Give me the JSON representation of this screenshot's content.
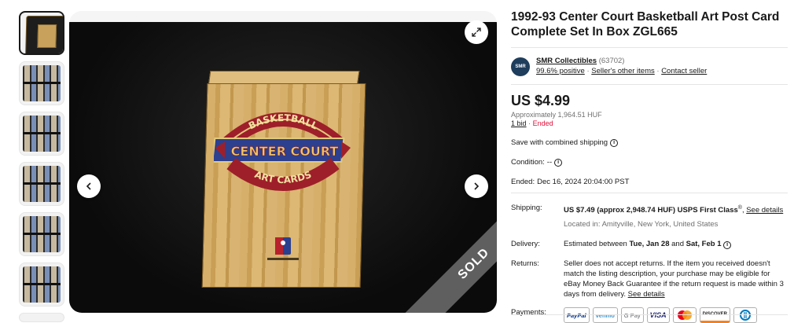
{
  "listing": {
    "title": "1992-93 Center Court Basketball Art Post Card Complete Set In Box ZGL665"
  },
  "gallery": {
    "sold_label": "SOLD",
    "box_logo": {
      "top_word": "BASKETBALL",
      "middle_word": "CENTER COURT",
      "bottom_word": "ART CARDS"
    }
  },
  "seller": {
    "avatar_text": "SMR",
    "name": "SMR Collectibles",
    "feedback_count": "(63702)",
    "positive": "99.6% positive",
    "other_items": "Seller's other items",
    "contact": "Contact seller",
    "sep": "·"
  },
  "price": {
    "main": "US $4.99",
    "approx_label": "Approximately",
    "approx_value": "1,964.51 HUF",
    "bids": "1 bid",
    "status": "Ended"
  },
  "shipping_note": "Save with combined shipping",
  "condition": {
    "label": "Condition:",
    "value": "--"
  },
  "ended": {
    "label": "Ended:",
    "value": "Dec 16, 2024 20:04:00 PST"
  },
  "details": {
    "shipping_label": "Shipping:",
    "shipping_value": "US $7.49 (approx 2,948.74 HUF) USPS First Class",
    "shipping_reg": "®",
    "shipping_link": "See details",
    "location": "Located in: Amityville, New York, United States",
    "delivery_label": "Delivery:",
    "delivery_prefix": "Estimated between",
    "delivery_start": "Tue, Jan 28",
    "delivery_and": "and",
    "delivery_end": "Sat, Feb 1",
    "returns_label": "Returns:",
    "returns_value": "Seller does not accept returns. If the item you received doesn't match the listing description, your purchase may be eligible for eBay Money Back Guarantee if the return request is made within 3 days from delivery.",
    "returns_link": "See details",
    "payments_label": "Payments:"
  },
  "payments": [
    "PayPal",
    "venmo",
    "G Pay",
    "VISA",
    "Mastercard",
    "DISCOVER",
    "Diners"
  ],
  "colors": {
    "ended_red": "#e0103a",
    "paypal_blue": "#003087",
    "venmo_blue": "#3d95ce",
    "visa_blue": "#1a1f71"
  }
}
